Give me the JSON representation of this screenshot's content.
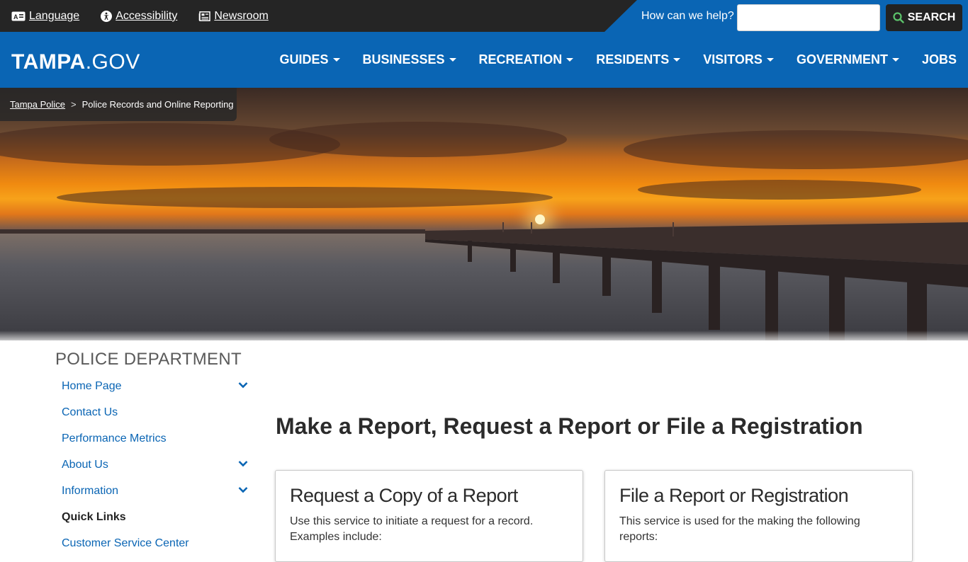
{
  "utility": {
    "language": "Language",
    "accessibility": "Accessibility",
    "newsroom": "Newsroom",
    "search_label": "How can we help?",
    "search_placeholder": "",
    "search_button": "SEARCH"
  },
  "logo": {
    "bold": "TAMPA",
    "thin": ".GOV"
  },
  "nav": {
    "items": [
      {
        "label": "GUIDES",
        "dropdown": true
      },
      {
        "label": "BUSINESSES",
        "dropdown": true
      },
      {
        "label": "RECREATION",
        "dropdown": true
      },
      {
        "label": "RESIDENTS",
        "dropdown": true
      },
      {
        "label": "VISITORS",
        "dropdown": true
      },
      {
        "label": "GOVERNMENT",
        "dropdown": true
      },
      {
        "label": "JOBS",
        "dropdown": false
      }
    ]
  },
  "breadcrumb": {
    "parent": "Tampa Police",
    "separator": ">",
    "current": "Police Records and Online Reporting"
  },
  "sidebar": {
    "title": "POLICE DEPARTMENT",
    "items": [
      {
        "label": "Home Page",
        "expandable": true
      },
      {
        "label": "Contact Us",
        "expandable": false
      },
      {
        "label": "Performance Metrics",
        "expandable": false
      },
      {
        "label": "About Us",
        "expandable": true
      },
      {
        "label": "Information",
        "expandable": true
      },
      {
        "label": "Quick Links",
        "expandable": false,
        "active": true
      },
      {
        "label": "Customer Service Center",
        "expandable": false
      }
    ]
  },
  "main": {
    "title": "Make a Report, Request a Report or File a Registration",
    "cards": [
      {
        "title": "Request a Copy of a Report",
        "text": "Use this service to initiate a request for a record. Examples include:"
      },
      {
        "title": "File a Report or Registration",
        "text": "This service is used for the making the following reports:"
      }
    ]
  },
  "colors": {
    "brand_blue": "#0a65b4",
    "utility_bg": "#252525",
    "search_button_bg": "#222222",
    "link": "#0a65b4"
  }
}
